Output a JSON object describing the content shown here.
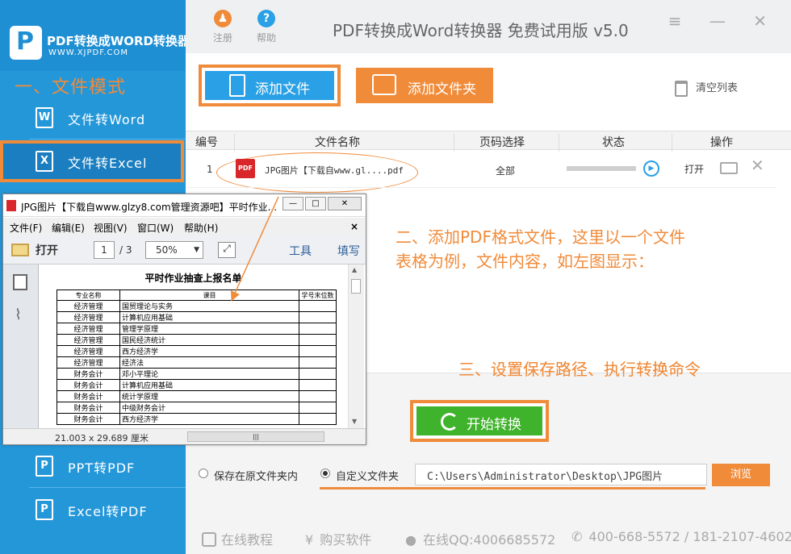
{
  "sidebar": {
    "logo_title": "PDF转换成WORD转换器",
    "logo_sub": "WWW.XJPDF.COM",
    "mode_title": "一、文件模式",
    "items": [
      {
        "label": "文件转Word",
        "icon": "W"
      },
      {
        "label": "文件转Excel",
        "icon": "X"
      },
      {
        "label": "PPT转PDF",
        "icon": "P"
      },
      {
        "label": "Excel转PDF",
        "icon": "P"
      }
    ]
  },
  "titlebar": {
    "register": "注册",
    "help": "帮助",
    "title": "PDF转换成Word转换器 免费试用版 v5.0",
    "menu_icon": "≡",
    "min_icon": "—",
    "close_icon": "✕"
  },
  "toolbar": {
    "add_file": "添加文件",
    "add_folder": "添加文件夹",
    "clear_list": "清空列表"
  },
  "table": {
    "headers": [
      "编号",
      "文件名称",
      "页码选择",
      "状态",
      "操作"
    ],
    "rows": [
      {
        "index": "1",
        "name": "JPG图片【下载自www.gl....pdf",
        "pages": "全部",
        "progress": 0,
        "action": "打开"
      }
    ]
  },
  "annotations": {
    "step2_line1": "二、添加PDF格式文件，这里以一个文件",
    "step2_line2": "表格为例，文件内容，如左图显示：",
    "step3": "三、设置保存路径、执行转换命令"
  },
  "save": {
    "option_original": "保存在原文件夹内",
    "option_custom": "自定义文件夹",
    "selected": "option_custom",
    "path": "C:\\Users\\Administrator\\Desktop\\JPG图片",
    "browse": "浏览",
    "start": "开始转换"
  },
  "footer": {
    "tutorial": "在线教程",
    "buy": "购买软件",
    "qq": "在线QQ:4006685572",
    "phone": "400-668-5572 / 181-2107-4602"
  },
  "viewer": {
    "title": "JPG图片【下载自www.glzy8.com管理资源吧】平时作业...",
    "menu": [
      "文件(F)",
      "编辑(E)",
      "视图(V)",
      "窗口(W)",
      "帮助(H)"
    ],
    "open": "打开",
    "page": "1",
    "page_total": "/ 3",
    "zoom": "50%",
    "tools": "工具",
    "fill": "填写",
    "status": "21.003 x 29.689 厘米",
    "doc_title": "平时作业抽查上报名单",
    "doc_headers": [
      "专业名称",
      "课目",
      "学号末位数"
    ],
    "doc_rows": [
      [
        "经济管理",
        "国贸理论与实务"
      ],
      [
        "经济管理",
        "计算机应用基础"
      ],
      [
        "经济管理",
        "管理学原理"
      ],
      [
        "经济管理",
        "国民经济统计"
      ],
      [
        "经济管理",
        "西方经济学"
      ],
      [
        "经济管理",
        "经济法"
      ],
      [
        "财务会计",
        "邓小平理论"
      ],
      [
        "财务会计",
        "计算机应用基础"
      ],
      [
        "财务会计",
        "统计学原理"
      ],
      [
        "财务会计",
        "中级财务会计"
      ],
      [
        "财务会计",
        "西方经济学"
      ]
    ]
  },
  "colors": {
    "sidebar": "#2497d9",
    "accent_orange": "#f08b3a",
    "button_blue": "#2aa0e6",
    "start_green": "#3fb32b"
  }
}
